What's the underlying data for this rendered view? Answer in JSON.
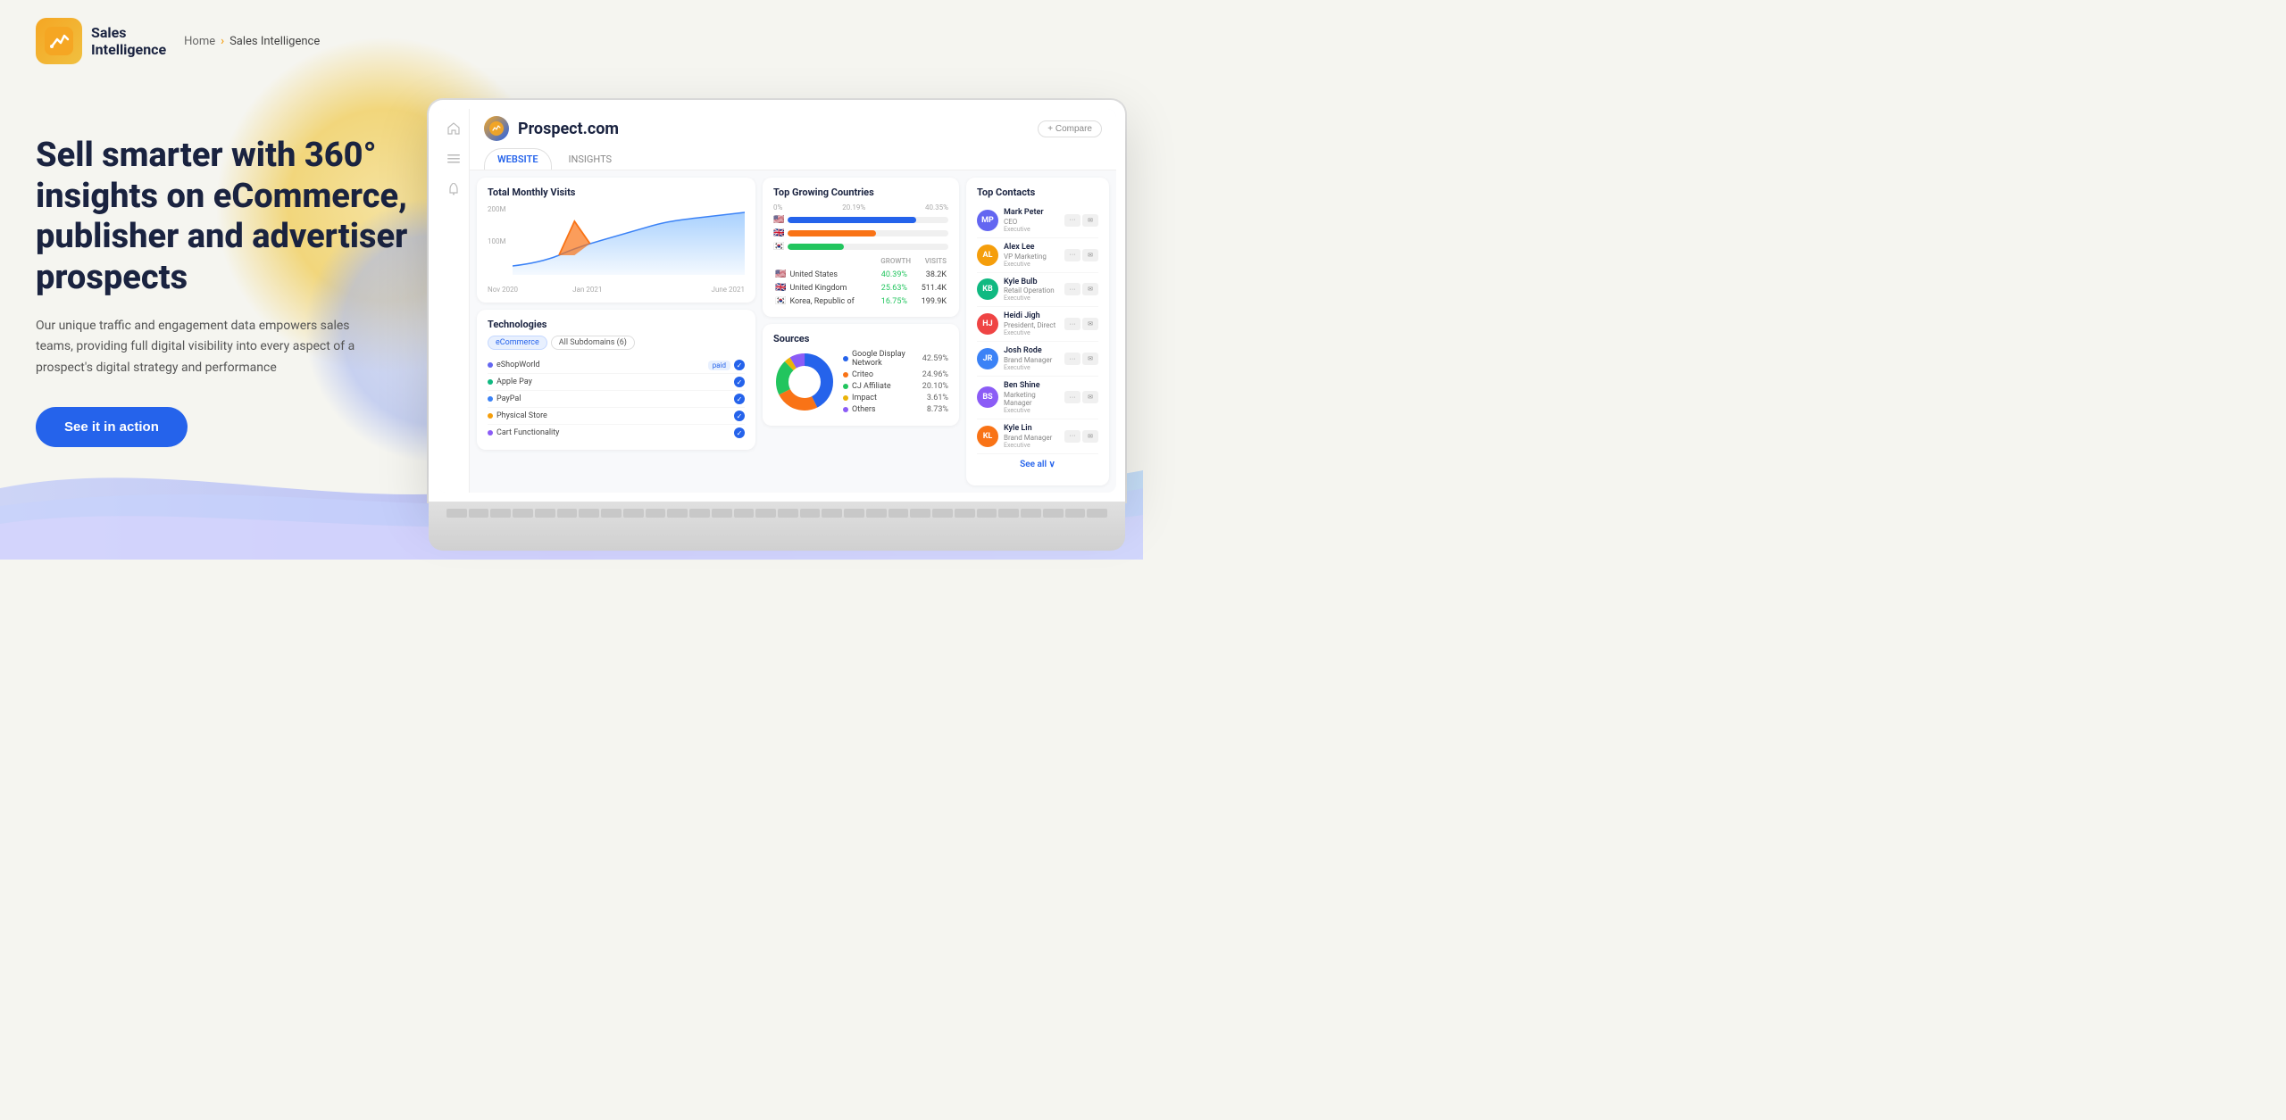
{
  "header": {
    "logo_sales": "Sales",
    "logo_intelligence": "Intelligence",
    "breadcrumb_home": "Home",
    "breadcrumb_sep": "›",
    "breadcrumb_current": "Sales Intelligence"
  },
  "hero": {
    "title": "Sell smarter with 360° insights on eCommerce, publisher and advertiser prospects",
    "description": "Our unique traffic and engagement data empowers sales teams, providing full digital visibility into every aspect of a prospect's digital strategy and performance",
    "cta_label": "See it in action"
  },
  "dashboard": {
    "company_name": "Prospect.com",
    "tabs": [
      "WEBSITE",
      "INSIGHTS"
    ],
    "compare_label": "+ Compare",
    "total_monthly_visits": {
      "title": "Total Monthly Visits",
      "y_labels": [
        "200M",
        "100M"
      ],
      "x_labels": [
        "Nov 2020",
        "Jan 2021",
        "",
        "June 2021"
      ]
    },
    "top_growing_countries": {
      "title": "Top Growing Countries",
      "bars": [
        {
          "flag": "🇺🇸",
          "pct": 40,
          "color": "#2563eb"
        },
        {
          "flag": "🇬🇧",
          "pct": 26,
          "color": "#f97316"
        },
        {
          "flag": "🇰🇷",
          "pct": 17,
          "color": "#22c55e"
        }
      ],
      "pct_labels": [
        "0%",
        "20.19%",
        "40.35%"
      ],
      "countries": [
        {
          "flag": "🇺🇸",
          "name": "United States",
          "growth": "40.39%",
          "visits": "38.2K"
        },
        {
          "flag": "🇬🇧",
          "name": "United Kingdom",
          "growth": "25.63%",
          "visits": "511.4K"
        },
        {
          "flag": "🇰🇷",
          "name": "Korea, Republic of",
          "growth": "16.75%",
          "visits": "199.9K"
        }
      ],
      "col_growth": "GROWTH",
      "col_visits": "VISITS"
    },
    "technologies": {
      "title": "Technologies",
      "tags": [
        "eCommerce",
        "All Subdomains (6)"
      ],
      "items": [
        {
          "name": "eShopWorld",
          "badge": "paid",
          "checked": true
        },
        {
          "name": "Apple Pay",
          "badge": "",
          "checked": true
        },
        {
          "name": "PayPal",
          "badge": "",
          "checked": true
        },
        {
          "name": "Physical Store",
          "badge": "",
          "checked": true
        },
        {
          "name": "Cart Functionality",
          "badge": "",
          "checked": true
        }
      ]
    },
    "sources": {
      "title": "Sources",
      "items": [
        {
          "name": "Google Display Network",
          "pct": "42.59%",
          "color": "#2563eb"
        },
        {
          "name": "Criteo",
          "pct": "24.96%",
          "color": "#f97316"
        },
        {
          "name": "CJ Affiliate",
          "pct": "20.10%",
          "color": "#22c55e"
        },
        {
          "name": "Impact",
          "pct": "3.61%",
          "color": "#eab308"
        },
        {
          "name": "Others",
          "pct": "8.73%",
          "color": "#8b5cf6"
        }
      ]
    },
    "top_contacts": {
      "title": "Top Contacts",
      "see_all": "See all",
      "contacts": [
        {
          "name": "Mark Peter",
          "role": "CEO",
          "title": "Executive",
          "color": "#6366f1"
        },
        {
          "name": "Alex Lee",
          "role": "VP Marketing",
          "title": "Executive",
          "color": "#f59e0b"
        },
        {
          "name": "Kyle Bulb",
          "role": "Retail Operation",
          "title": "Executive",
          "color": "#10b981"
        },
        {
          "name": "Heidi Jigh",
          "role": "President, Direct",
          "title": "Executive",
          "color": "#ef4444"
        },
        {
          "name": "Josh Rode",
          "role": "Brand Manager",
          "title": "Executive",
          "color": "#3b82f6"
        },
        {
          "name": "Ben Shine",
          "role": "Marketing Manager",
          "title": "Executive",
          "color": "#8b5cf6"
        },
        {
          "name": "Kyle Lin",
          "role": "Brand Manager",
          "title": "Executive",
          "color": "#f97316"
        }
      ]
    }
  },
  "colors": {
    "accent_blue": "#2563eb",
    "accent_orange": "#f97316",
    "brand_yellow": "#f5a623",
    "text_dark": "#1a2340",
    "bg_light": "#f5f5f0"
  }
}
